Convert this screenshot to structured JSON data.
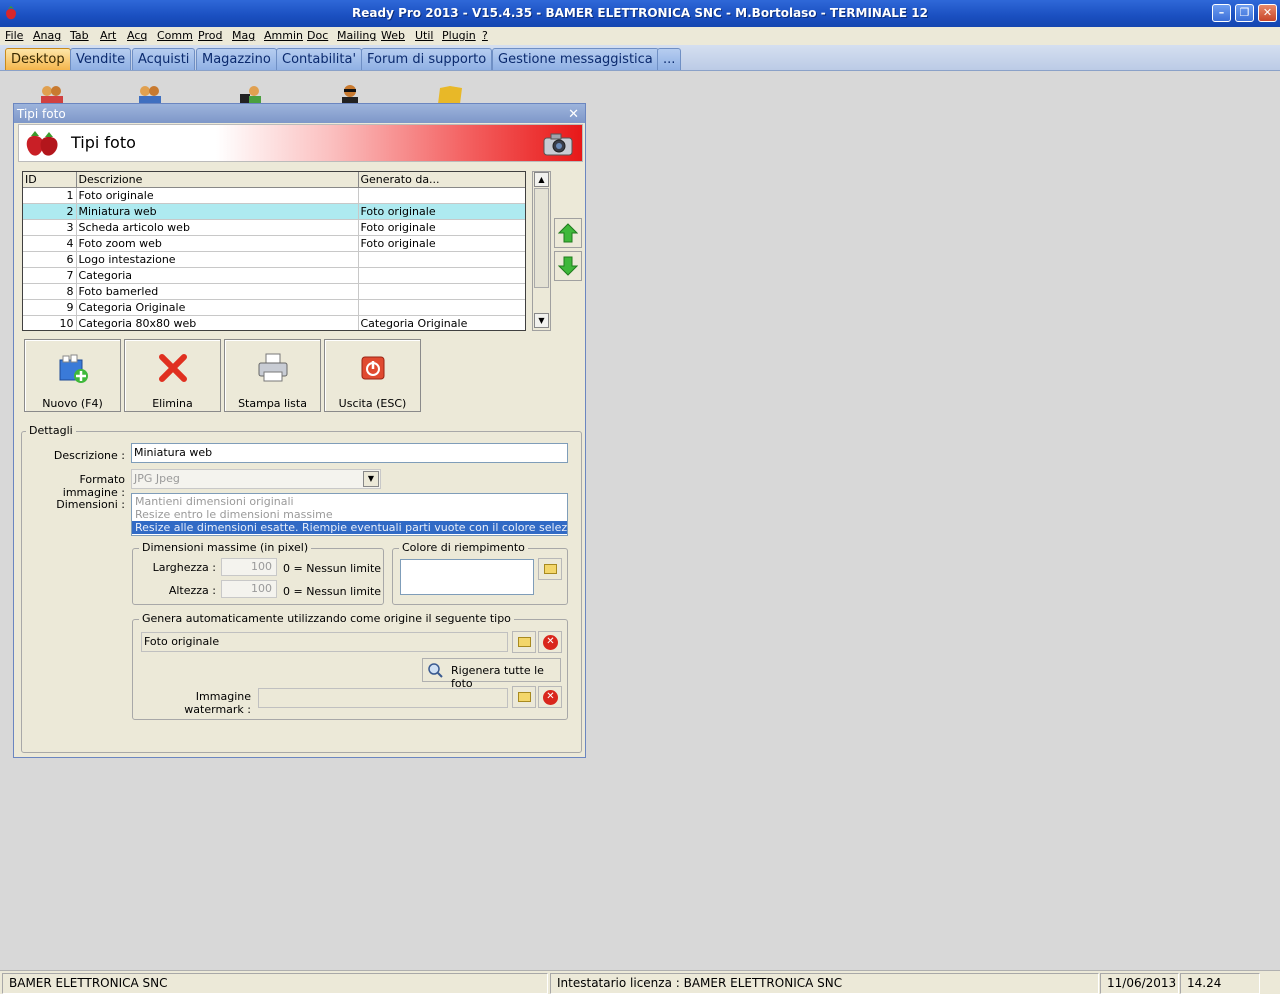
{
  "window": {
    "title": "Ready Pro 2013 - V15.4.35 - BAMER ELETTRONICA SNC - M.Bortolaso - TERMINALE 12"
  },
  "menu": [
    "File",
    "Anag",
    "Tab",
    "Art",
    "Acq",
    "Comm",
    "Prod",
    "Mag",
    "Ammin",
    "Doc",
    "Mailing",
    "Web",
    "Util",
    "Plugin",
    "?"
  ],
  "tabs": [
    "Desktop",
    "Vendite",
    "Acquisti",
    "Magazzino",
    "Contabilita'",
    "Forum di supporto",
    "Gestione messaggistica",
    "..."
  ],
  "dialog": {
    "window_title": "Tipi foto",
    "banner_title": "Tipi foto",
    "grid": {
      "columns": [
        "ID",
        "Descrizione",
        "Generato da..."
      ],
      "rows": [
        {
          "id": "1",
          "descrizione": "Foto originale",
          "generato": ""
        },
        {
          "id": "2",
          "descrizione": "Miniatura web",
          "generato": "Foto originale"
        },
        {
          "id": "3",
          "descrizione": "Scheda articolo web",
          "generato": "Foto originale"
        },
        {
          "id": "4",
          "descrizione": "Foto zoom web",
          "generato": "Foto originale"
        },
        {
          "id": "6",
          "descrizione": "Logo intestazione",
          "generato": ""
        },
        {
          "id": "7",
          "descrizione": "Categoria",
          "generato": ""
        },
        {
          "id": "8",
          "descrizione": "Foto bamerled",
          "generato": ""
        },
        {
          "id": "9",
          "descrizione": "Categoria Originale",
          "generato": ""
        },
        {
          "id": "10",
          "descrizione": "Categoria 80x80 web",
          "generato": "Categoria Originale"
        }
      ],
      "selected_row": 2
    },
    "buttons": {
      "nuovo": "Nuovo (F4)",
      "elimina": "Elimina",
      "stampa": "Stampa lista",
      "uscita": "Uscita (ESC)"
    },
    "dettagli": {
      "legend": "Dettagli",
      "descrizione_label": "Descrizione :",
      "descrizione_value": "Miniatura web",
      "formato_label": "Formato immagine :",
      "formato_value": "JPG Jpeg",
      "dimensioni_label": "Dimensioni :",
      "dimensioni_options": [
        "Mantieni dimensioni originali",
        "Resize entro le dimensioni massime",
        "Resize alle dimensioni esatte. Riempie eventuali parti vuote con il colore selezionato."
      ],
      "dimensioni_selected": 2,
      "dim_max_legend": "Dimensioni massime (in pixel)",
      "larghezza_label": "Larghezza :",
      "larghezza_value": "100",
      "altezza_label": "Altezza :",
      "altezza_value": "100",
      "nessun_limite": "0 = Nessun limite",
      "colore_legend": "Colore di riempimento",
      "genera_legend": "Genera automaticamente utilizzando come origine il seguente tipo",
      "origine_value": "Foto originale",
      "rigenera_label": "Rigenera tutte le foto",
      "watermark_label": "Immagine watermark :",
      "watermark_value": ""
    }
  },
  "statusbar": {
    "company": "BAMER ELETTRONICA SNC",
    "license": "Intestatario licenza : BAMER ELETTRONICA SNC",
    "date": "11/06/2013",
    "time": "14.24"
  },
  "colors": {
    "titlebar": "#1a4fc0",
    "selected_row": "#aeeaf0",
    "active_tab": "#f4b54c",
    "list_selection": "#316ac5"
  }
}
